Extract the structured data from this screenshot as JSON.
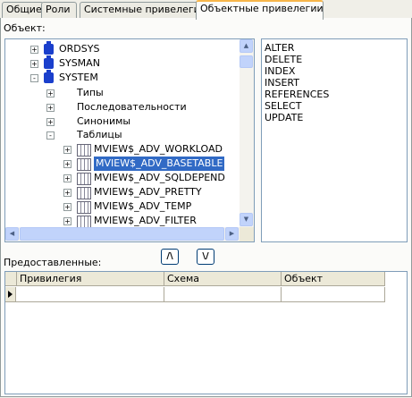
{
  "tabs": [
    "Общие",
    "Роли",
    "Системные привелегии",
    "Объектные привелегии"
  ],
  "active_tab": "Объектные привелегии",
  "object_label": "Объект:",
  "tree": {
    "nodes": [
      {
        "label": "ORDSYS",
        "expander": "+",
        "icon": "database-icon"
      },
      {
        "label": "SYSMAN",
        "expander": "+",
        "icon": "database-icon"
      },
      {
        "label": "SYSTEM",
        "expander": "-",
        "icon": "database-icon"
      },
      {
        "label": "Типы",
        "expander": "+"
      },
      {
        "label": "Последовательности",
        "expander": "+"
      },
      {
        "label": "Синонимы",
        "expander": "+"
      },
      {
        "label": "Таблицы",
        "expander": "-"
      },
      {
        "label": "MVIEW$_ADV_WORKLOAD",
        "expander": "+",
        "icon": "table-icon"
      },
      {
        "label": "MVIEW$_ADV_BASETABLE",
        "expander": "+",
        "icon": "table-icon",
        "selected": true
      },
      {
        "label": "MVIEW$_ADV_SQLDEPEND",
        "expander": "+",
        "icon": "table-icon"
      },
      {
        "label": "MVIEW$_ADV_PRETTY",
        "expander": "+",
        "icon": "table-icon"
      },
      {
        "label": "MVIEW$_ADV_TEMP",
        "expander": "+",
        "icon": "table-icon"
      },
      {
        "label": "MVIEW$_ADV_FILTER",
        "expander": "+",
        "icon": "table-icon"
      }
    ]
  },
  "privileges": [
    "ALTER",
    "DELETE",
    "INDEX",
    "INSERT",
    "REFERENCES",
    "SELECT",
    "UPDATE"
  ],
  "granted_label": "Предоставленные:",
  "move_up_label": "/\\",
  "move_down_label": "\\/",
  "grid": {
    "columns": [
      "Привилегия",
      "Схема",
      "Объект"
    ]
  }
}
